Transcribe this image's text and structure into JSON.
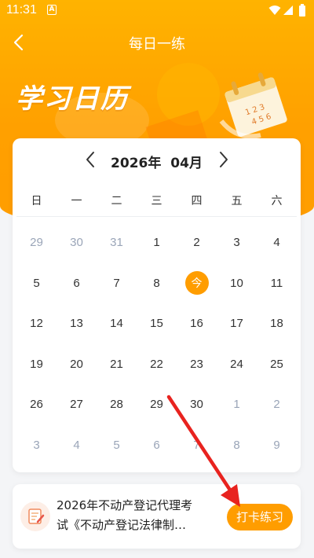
{
  "status_bar": {
    "time": "11:31",
    "notification_glyph": "A"
  },
  "nav": {
    "title": "每日一练"
  },
  "banner": {
    "title": "学习日历"
  },
  "calendar": {
    "year": "2026年",
    "month": "04月",
    "weekdays": [
      "日",
      "一",
      "二",
      "三",
      "四",
      "五",
      "六"
    ],
    "weeks": [
      [
        {
          "d": "29",
          "o": true
        },
        {
          "d": "30",
          "o": true
        },
        {
          "d": "31",
          "o": true
        },
        {
          "d": "1"
        },
        {
          "d": "2"
        },
        {
          "d": "3"
        },
        {
          "d": "4"
        }
      ],
      [
        {
          "d": "5"
        },
        {
          "d": "6"
        },
        {
          "d": "7"
        },
        {
          "d": "8"
        },
        {
          "d": "今",
          "today": true
        },
        {
          "d": "10"
        },
        {
          "d": "11"
        }
      ],
      [
        {
          "d": "12"
        },
        {
          "d": "13"
        },
        {
          "d": "14"
        },
        {
          "d": "15"
        },
        {
          "d": "16"
        },
        {
          "d": "17"
        },
        {
          "d": "18"
        }
      ],
      [
        {
          "d": "19"
        },
        {
          "d": "20"
        },
        {
          "d": "21"
        },
        {
          "d": "22"
        },
        {
          "d": "23"
        },
        {
          "d": "24"
        },
        {
          "d": "25"
        }
      ],
      [
        {
          "d": "26"
        },
        {
          "d": "27"
        },
        {
          "d": "28"
        },
        {
          "d": "29"
        },
        {
          "d": "30"
        },
        {
          "d": "1",
          "o": true
        },
        {
          "d": "2",
          "o": true
        }
      ],
      [
        {
          "d": "3",
          "o": true
        },
        {
          "d": "4",
          "o": true
        },
        {
          "d": "5",
          "o": true
        },
        {
          "d": "6",
          "o": true
        },
        {
          "d": "7",
          "o": true
        },
        {
          "d": "8",
          "o": true
        },
        {
          "d": "9",
          "o": true
        }
      ]
    ]
  },
  "task": {
    "line1": "2026年不动产登记代理考",
    "line2": "试《不动产登记法律制…",
    "button_label": "打卡练习"
  },
  "colors": {
    "accent": "#ff9d00",
    "other_month": "#9aa5b8",
    "annotation_arrow": "#e8231f"
  },
  "icons": [
    "back-arrow-icon",
    "chevron-left-icon",
    "chevron-right-icon",
    "wifi-icon",
    "signal-icon",
    "battery-icon",
    "calendar-illustration",
    "exam-thumbnail-icon"
  ]
}
